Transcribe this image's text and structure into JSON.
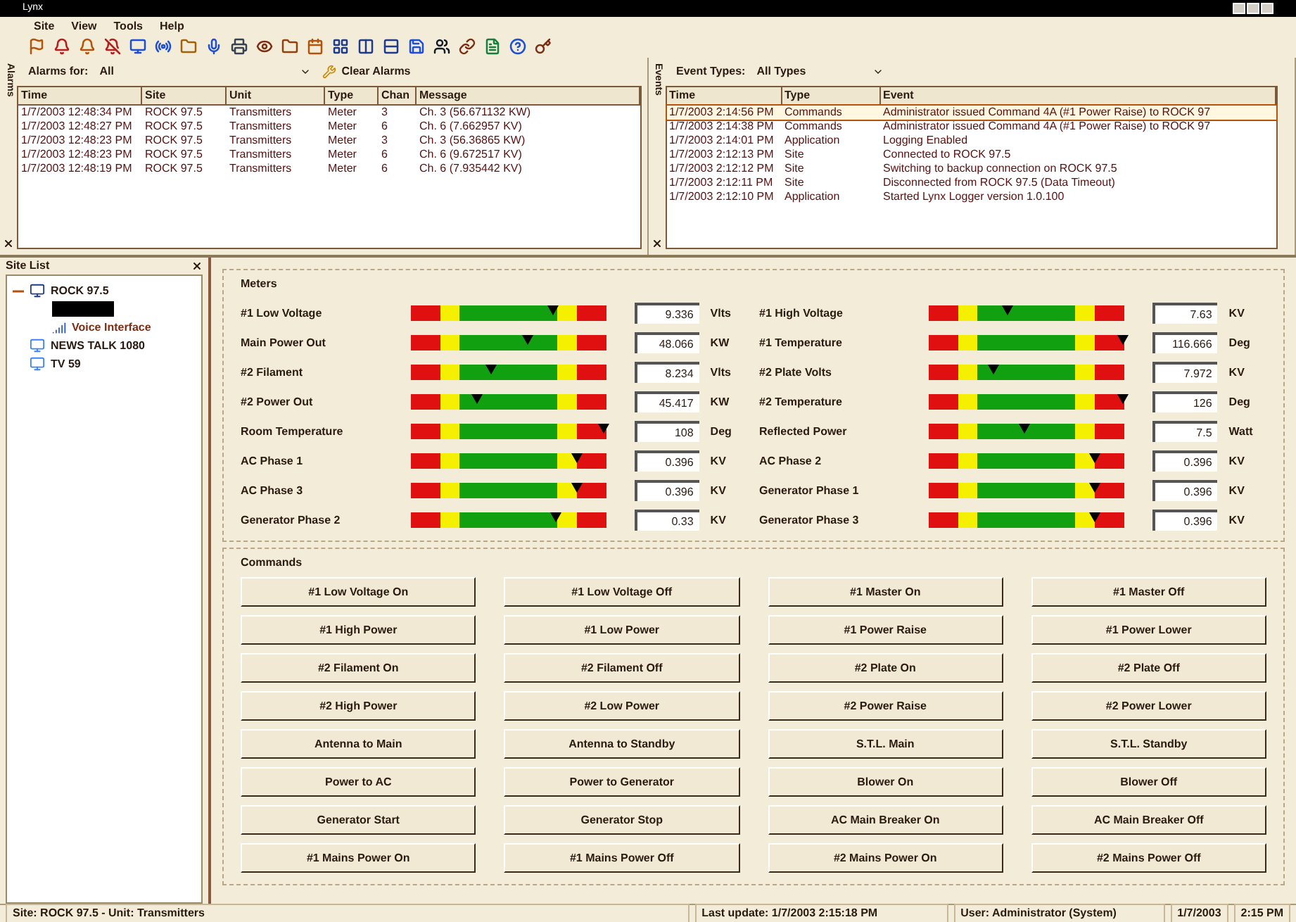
{
  "window": {
    "title": "Lynx"
  },
  "menu": [
    "Site",
    "View",
    "Tools",
    "Help"
  ],
  "alarms": {
    "panel_label": "Alarms",
    "filter_label": "Alarms for:",
    "filter_value": "All",
    "clear_button": "Clear Alarms",
    "columns": [
      "Time",
      "Site",
      "Unit",
      "Type",
      "Chan",
      "Message"
    ],
    "rows": [
      [
        "1/7/2003 12:48:34 PM",
        "ROCK 97.5",
        "Transmitters",
        "Meter",
        "3",
        "Ch. 3 (56.671132 KW)"
      ],
      [
        "1/7/2003 12:48:27 PM",
        "ROCK 97.5",
        "Transmitters",
        "Meter",
        "6",
        "Ch. 6 (7.662957 KV)"
      ],
      [
        "1/7/2003 12:48:23 PM",
        "ROCK 97.5",
        "Transmitters",
        "Meter",
        "3",
        "Ch. 3 (56.36865 KW)"
      ],
      [
        "1/7/2003 12:48:23 PM",
        "ROCK 97.5",
        "Transmitters",
        "Meter",
        "6",
        "Ch. 6 (9.672517 KV)"
      ],
      [
        "1/7/2003 12:48:19 PM",
        "ROCK 97.5",
        "Transmitters",
        "Meter",
        "6",
        "Ch. 6 (7.935442 KV)"
      ]
    ]
  },
  "events": {
    "panel_label": "Events",
    "filter_label": "Event Types:",
    "filter_value": "All Types",
    "columns": [
      "Time",
      "Type",
      "Event"
    ],
    "rows": [
      {
        "cells": [
          "1/7/2003 2:14:56 PM",
          "Commands",
          "Administrator issued Command 4A (#1 Power Raise) to ROCK 97"
        ],
        "selected": true
      },
      {
        "cells": [
          "1/7/2003 2:14:38 PM",
          "Commands",
          "Administrator issued Command 4A (#1 Power Raise) to ROCK 97"
        ],
        "selected": false
      },
      {
        "cells": [
          "1/7/2003 2:14:01 PM",
          "Application",
          "Logging Enabled"
        ],
        "selected": false
      },
      {
        "cells": [
          "1/7/2003 2:12:13 PM",
          "Site",
          "Connected to ROCK 97.5"
        ],
        "selected": false
      },
      {
        "cells": [
          "1/7/2003 2:12:12 PM",
          "Site",
          "Switching to backup connection on ROCK 97.5"
        ],
        "selected": false
      },
      {
        "cells": [
          "1/7/2003 2:12:11 PM",
          "Site",
          "Disconnected from ROCK 97.5 (Data Timeout)"
        ],
        "selected": false
      },
      {
        "cells": [
          "1/7/2003 2:12:10 PM",
          "Application",
          "Started Lynx Logger version 1.0.100"
        ],
        "selected": false
      }
    ]
  },
  "site_list": {
    "title": "Site List",
    "items": [
      {
        "label": "ROCK 97.5",
        "expanded": true,
        "children": [
          {
            "kind": "redacted"
          },
          {
            "kind": "item",
            "label": "Voice Interface"
          }
        ]
      },
      {
        "label": "NEWS TALK 1080"
      },
      {
        "label": "TV 59"
      }
    ]
  },
  "meters": {
    "title": "Meters",
    "items": [
      {
        "name": "#1 Low Voltage",
        "level": 0.73,
        "reading": "9.336",
        "unit": "Vlts"
      },
      {
        "name": "#1 High Voltage",
        "level": 0.4,
        "reading": "7.63",
        "unit": "KV"
      },
      {
        "name": "Main Power Out",
        "level": 0.6,
        "reading": "48.066",
        "unit": "KW"
      },
      {
        "name": "#1 Temperature",
        "level": 0.99,
        "reading": "116.666",
        "unit": "Deg"
      },
      {
        "name": "#2 Filament",
        "level": 0.41,
        "reading": "8.234",
        "unit": "Vlts"
      },
      {
        "name": "#2 Plate Volts",
        "level": 0.33,
        "reading": "7.972",
        "unit": "KV"
      },
      {
        "name": "#2 Power Out",
        "level": 0.34,
        "reading": "45.417",
        "unit": "KW"
      },
      {
        "name": "#2 Temperature",
        "level": 0.99,
        "reading": "126",
        "unit": "Deg"
      },
      {
        "name": "Room Temperature",
        "level": 0.99,
        "reading": "108",
        "unit": "Deg"
      },
      {
        "name": "Reflected Power",
        "level": 0.49,
        "reading": "7.5",
        "unit": "Watt"
      },
      {
        "name": "AC Phase 1",
        "level": 0.85,
        "reading": "0.396",
        "unit": "KV"
      },
      {
        "name": "AC Phase 2",
        "level": 0.85,
        "reading": "0.396",
        "unit": "KV"
      },
      {
        "name": "AC Phase 3",
        "level": 0.85,
        "reading": "0.396",
        "unit": "KV"
      },
      {
        "name": "Generator Phase 1",
        "level": 0.85,
        "reading": "0.396",
        "unit": "KV"
      },
      {
        "name": "Generator Phase 2",
        "level": 0.74,
        "reading": "0.33",
        "unit": "KV"
      },
      {
        "name": "Generator Phase 3",
        "level": 0.85,
        "reading": "0.396",
        "unit": "KV"
      }
    ]
  },
  "commands": {
    "title": "Commands",
    "buttons": [
      "#1 Low Voltage On",
      "#1 Low Voltage Off",
      "#1 Master On",
      "#1 Master Off",
      "#1 High Power",
      "#1 Low Power",
      "#1 Power Raise",
      "#1 Power Lower",
      "#2 Filament On",
      "#2 Filament Off",
      "#2 Plate On",
      "#2 Plate Off",
      "#2 High Power",
      "#2 Low Power",
      "#2 Power Raise",
      "#2 Power Lower",
      "Antenna to Main",
      "Antenna to Standby",
      "S.T.L. Main",
      "S.T.L. Standby",
      "Power to AC",
      "Power to Generator",
      "Blower On",
      "Blower Off",
      "Generator Start",
      "Generator Stop",
      "AC Main Breaker On",
      "AC Main Breaker Off",
      "#1 Mains Power On",
      "#1 Mains Power Off",
      "#2 Mains Power On",
      "#2 Mains Power Off"
    ]
  },
  "status_bar": [
    "Site: ROCK 97.5 - Unit: Transmitters",
    "Last update: 1/7/2003 2:15:18 PM",
    "User: Administrator (System)",
    "1/7/2003",
    "2:15 PM"
  ]
}
